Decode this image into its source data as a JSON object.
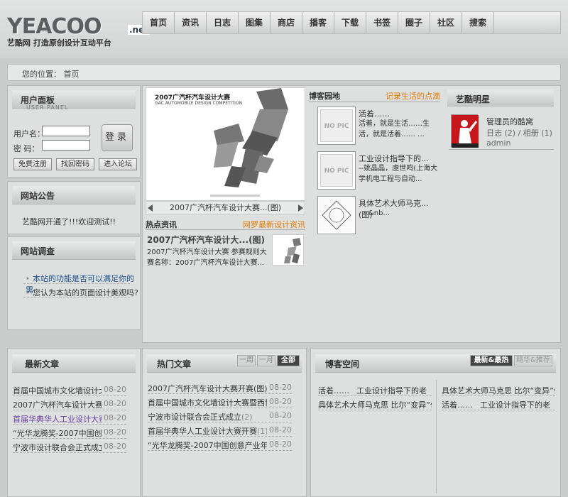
{
  "brand": {
    "logo": "YEACOO",
    "logo_suffix": ".net",
    "slogan": "艺酷网  打造原创设计互动平台"
  },
  "nav": [
    "首页",
    "资讯",
    "日志",
    "图集",
    "商店",
    "播客",
    "下载",
    "书签",
    "圈子",
    "社区",
    "搜索"
  ],
  "breadcrumb": {
    "label": "您的位置：",
    "current": "首页"
  },
  "user_panel": {
    "title": "用户面板",
    "subtitle": "USER PANEL",
    "username_label": "用户名：",
    "password_label": "密    码：",
    "login_button": "登录",
    "register_button": "免费注册",
    "recover_button": "找回密码",
    "forum_button": "进入论坛"
  },
  "notice": {
    "title": "网站公告",
    "text": "艺酷网开通了!!!欢迎测试!!"
  },
  "survey": {
    "title": "网站调查",
    "items": [
      "本站的功能是否可以满足你的需",
      "您认为本站的页面设计美观吗?"
    ]
  },
  "slideshow": {
    "poster_title": "2007广汽杯汽车设计大赛",
    "poster_subtitle": "GAC AUTOMOBILE DESIGN COMPETITION",
    "caption": "2007广汽杯汽车设计大赛...(图)"
  },
  "hot_news": {
    "title": "热点资讯",
    "link": "网罗最新设计资讯",
    "headline": "2007广汽杯汽车设计大...(图)",
    "summary": "2007广汽杯汽车设计大赛 参赛规则大赛名称：2007广汽杯汽车设计大赛..."
  },
  "blog_land": {
    "title": "博客园地",
    "link": "记录生活的点滴",
    "no_pic": "NO PIC",
    "entries": [
      {
        "name": "活着……",
        "desc": "活着，就是生活……生活，就是活着…… ..."
      },
      {
        "name": "工业设计指导下的...",
        "desc": "--姚晶晶，虞世鸣(上海大学机电工程与自动..."
      },
      {
        "name": "具体艺术大师马克...(图)",
        "desc": "&nb..."
      }
    ]
  },
  "star": {
    "title": "艺酷明星",
    "name": "管理员的酷窝",
    "stats": "日志 (2) / 相册 (1)",
    "user": "admin"
  },
  "latest_articles": {
    "title": "最新文章",
    "items": [
      {
        "title": "首届中国城市文化墙设计大赛",
        "date": "08-20",
        "highlight": false
      },
      {
        "title": "2007广汽杯汽车设计大赛开赛",
        "date": "08-20",
        "highlight": false
      },
      {
        "title": "首届华典华人工业设计大赛开",
        "date": "08-20",
        "highlight": true
      },
      {
        "title": "“光华龙腾奖-2007中国创意",
        "date": "08-20",
        "highlight": false
      },
      {
        "title": "宁波市设计联合会正式成立",
        "date": "08-20",
        "highlight": false
      }
    ]
  },
  "hot_articles": {
    "title": "热门文章",
    "tabs": [
      "一周",
      "一月",
      "全部"
    ],
    "items": [
      {
        "title": "2007广汽杯汽车设计大赛开赛(图)",
        "count": "(6)",
        "date": "08-20"
      },
      {
        "title": "首届中国城市文化墙设计大赛暨西博会文",
        "count": "",
        "date": "08-20"
      },
      {
        "title": "宁波市设计联合会正式成立",
        "count": "(2)",
        "date": "08-20"
      },
      {
        "title": "首届华典华人工业设计大赛开赛",
        "count": "(1)",
        "date": "08-20"
      },
      {
        "title": "“光华龙腾奖-2007中国创意产业年度大",
        "count": "",
        "date": "08-20"
      }
    ]
  },
  "blog_space": {
    "title": "博客空间",
    "tabs": [
      "最新&最热",
      "精华&推荐"
    ],
    "left": [
      {
        "a": "活着……",
        "b": "工业设计指导下的老"
      },
      {
        "a": "具体艺术大师马克思 比尔“变异”作",
        "b": ""
      }
    ],
    "right": [
      {
        "a": "具体艺术大师马克思 比尔“变异”作",
        "b": ""
      },
      {
        "a": "活着……",
        "b": "工业设计指导下的老"
      }
    ]
  },
  "colors": {
    "accent": "#e07a00",
    "highlight_link": "#6a3fa0",
    "bg": "#c9cccb",
    "panel": "#dde0df"
  }
}
